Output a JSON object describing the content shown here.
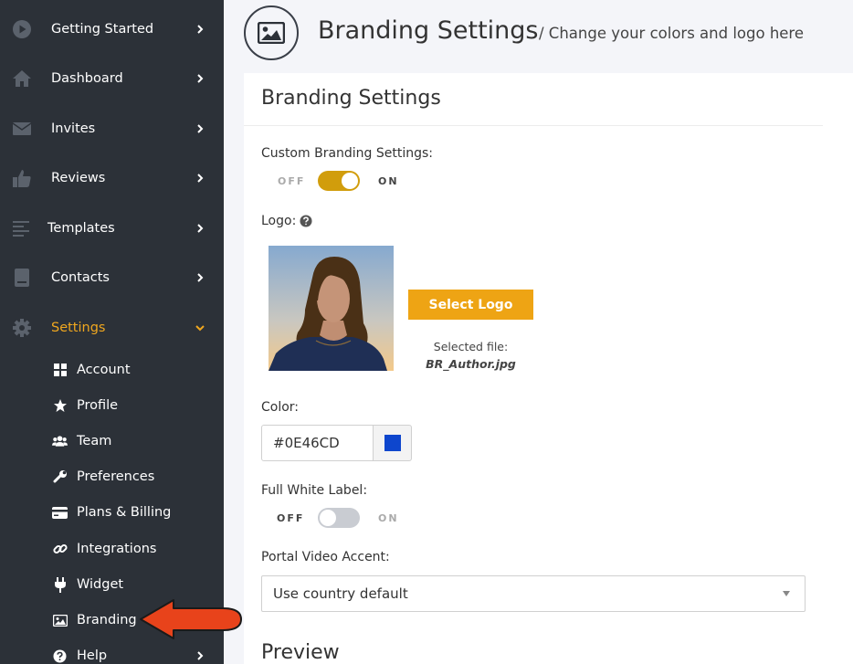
{
  "sidebar": {
    "items": [
      {
        "label": "Getting Started",
        "icon": "play-circle-icon"
      },
      {
        "label": "Dashboard",
        "icon": "home-icon"
      },
      {
        "label": "Invites",
        "icon": "envelope-icon"
      },
      {
        "label": "Reviews",
        "icon": "thumbs-up-icon"
      },
      {
        "label": "Templates",
        "icon": "align-left-icon"
      },
      {
        "label": "Contacts",
        "icon": "address-book-icon"
      },
      {
        "label": "Settings",
        "icon": "gear-icon"
      }
    ],
    "subitems": [
      {
        "label": "Account",
        "icon": "grid-icon"
      },
      {
        "label": "Profile",
        "icon": "star-icon"
      },
      {
        "label": "Team",
        "icon": "users-icon"
      },
      {
        "label": "Preferences",
        "icon": "wrench-icon"
      },
      {
        "label": "Plans & Billing",
        "icon": "credit-card-icon"
      },
      {
        "label": "Integrations",
        "icon": "link-icon"
      },
      {
        "label": "Widget",
        "icon": "plug-icon"
      },
      {
        "label": "Branding",
        "icon": "image-icon"
      },
      {
        "label": "Help",
        "icon": "question-circle-icon"
      }
    ]
  },
  "header": {
    "title": "Branding Settings",
    "subtitle": "/ Change your colors and logo here",
    "icon": "image-icon"
  },
  "panel": {
    "title": "Branding Settings",
    "custom_branding": {
      "label": "Custom Branding Settings:",
      "off": "OFF",
      "on": "ON",
      "enabled": true
    },
    "logo": {
      "label": "Logo:",
      "button": "Select Logo",
      "selected_label": "Selected file:",
      "file_name": "BR_Author.jpg"
    },
    "color": {
      "label": "Color:",
      "value": "#0E46CD"
    },
    "white_label": {
      "label": "Full White Label:",
      "off": "OFF",
      "on": "ON",
      "enabled": false
    },
    "video_accent": {
      "label": "Portal Video Accent:",
      "value": "Use country default"
    },
    "preview_title": "Preview"
  },
  "colors": {
    "sidebar_bg": "#2c3138",
    "accent": "#eea414",
    "active_nav": "#f0a71f",
    "brand_color": "#0E46CD",
    "arrow": "#e8431b"
  }
}
